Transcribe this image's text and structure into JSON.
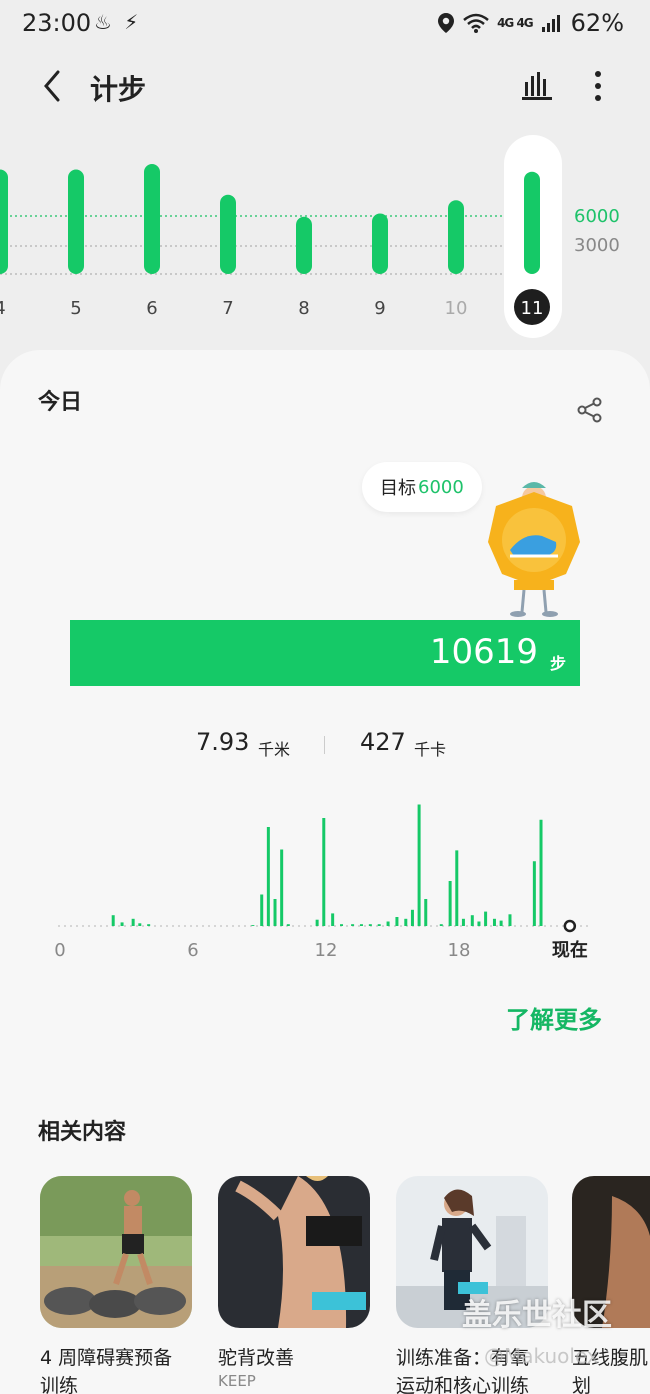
{
  "status": {
    "time": "23:00",
    "network": "4G 4G",
    "battery": "62%"
  },
  "header": {
    "title": "计步"
  },
  "week_chart": {
    "days": [
      "4",
      "5",
      "6",
      "7",
      "8",
      "9",
      "10",
      "11"
    ],
    "selected_day": "11",
    "goal_label": "6000",
    "mid_label": "3000",
    "relative_heights": [
      0.95,
      0.95,
      1.0,
      0.72,
      0.52,
      0.55,
      0.67,
      0.93
    ]
  },
  "today": {
    "label": "今日",
    "goal_prefix": "目标",
    "goal_value": "6000",
    "steps": "10619",
    "steps_unit": "步",
    "distance": "7.93",
    "distance_unit": "千米",
    "calories": "427",
    "calories_unit": "千卡"
  },
  "chart_data": {
    "type": "bar",
    "x_tick_labels": [
      "0",
      "6",
      "12",
      "18",
      "现在"
    ],
    "x": [
      2.4,
      2.8,
      3.3,
      3.6,
      4.0,
      8.7,
      9.1,
      9.4,
      9.7,
      10.0,
      10.3,
      11.6,
      11.9,
      12.3,
      12.7,
      13.2,
      13.6,
      14.0,
      14.4,
      14.8,
      15.2,
      15.6,
      15.9,
      16.2,
      16.5,
      17.2,
      17.6,
      17.9,
      18.2,
      18.6,
      18.9,
      19.2,
      19.6,
      19.9,
      20.3,
      21.4,
      21.7
    ],
    "values": [
      12,
      4,
      8,
      3,
      2,
      1,
      35,
      110,
      30,
      85,
      2,
      7,
      120,
      14,
      2,
      2,
      2,
      2,
      2,
      5,
      10,
      8,
      18,
      135,
      30,
      2,
      50,
      84,
      8,
      12,
      5,
      16,
      8,
      6,
      13,
      72,
      118
    ],
    "xlim": [
      0,
      24
    ],
    "ylim": [
      0,
      140
    ],
    "now_x": 23.0
  },
  "learn_more": "了解更多",
  "related": {
    "title": "相关内容",
    "items": [
      {
        "title_line1": "4 周障碍赛预备",
        "title_line2": "训练",
        "sub": ""
      },
      {
        "title_line1": "驼背改善",
        "title_line2": "",
        "sub": "KEEP"
      },
      {
        "title_line1": "训练准备：有氧",
        "title_line2": "运动和核心训练",
        "sub": ""
      },
      {
        "title_line1": "五线腹肌",
        "title_line2": "划",
        "sub": ""
      }
    ]
  },
  "watermark": "盖乐世社区",
  "watermark_sub": "@Makuolex",
  "colors": {
    "accent": "#15c967",
    "accent_text": "#1ec26a",
    "bar_dark": "#1e1e1e"
  }
}
